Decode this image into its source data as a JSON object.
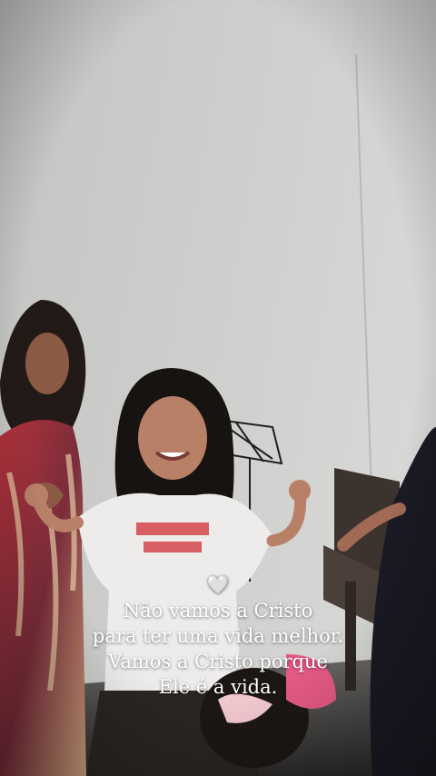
{
  "story": {
    "emoji": "🤍",
    "caption_lines": [
      "Não vamos a Cristo",
      "para ter uma vida melhor.",
      "Vamos a Cristo porque",
      "Ele é a vida."
    ],
    "shirt_text_lines": [
      "\"",
      "\""
    ]
  },
  "colors": {
    "wall": "#c9c9c7",
    "text": "#ffffff"
  }
}
